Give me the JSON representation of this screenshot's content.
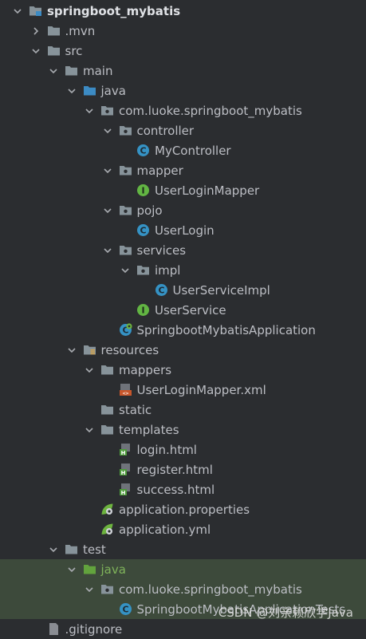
{
  "project_tree": {
    "items": [
      {
        "label": "springboot_mybatis",
        "depth": 0,
        "arrow": "down",
        "icon": "folder-module",
        "bold": true
      },
      {
        "label": ".mvn",
        "depth": 1,
        "arrow": "right",
        "icon": "folder"
      },
      {
        "label": "src",
        "depth": 1,
        "arrow": "down",
        "icon": "folder"
      },
      {
        "label": "main",
        "depth": 2,
        "arrow": "down",
        "icon": "folder"
      },
      {
        "label": "java",
        "depth": 3,
        "arrow": "down",
        "icon": "folder-source"
      },
      {
        "label": "com.luoke.springboot_mybatis",
        "depth": 4,
        "arrow": "down",
        "icon": "package"
      },
      {
        "label": "controller",
        "depth": 5,
        "arrow": "down",
        "icon": "package"
      },
      {
        "label": "MyController",
        "depth": 6,
        "arrow": "none",
        "icon": "class"
      },
      {
        "label": "mapper",
        "depth": 5,
        "arrow": "down",
        "icon": "package"
      },
      {
        "label": "UserLoginMapper",
        "depth": 6,
        "arrow": "none",
        "icon": "interface"
      },
      {
        "label": "pojo",
        "depth": 5,
        "arrow": "down",
        "icon": "package"
      },
      {
        "label": "UserLogin",
        "depth": 6,
        "arrow": "none",
        "icon": "class"
      },
      {
        "label": "services",
        "depth": 5,
        "arrow": "down",
        "icon": "package"
      },
      {
        "label": "impl",
        "depth": 6,
        "arrow": "down",
        "icon": "package"
      },
      {
        "label": "UserServiceImpl",
        "depth": 7,
        "arrow": "none",
        "icon": "class"
      },
      {
        "label": "UserService",
        "depth": 6,
        "arrow": "none",
        "icon": "interface"
      },
      {
        "label": "SpringbootMybatisApplication",
        "depth": 5,
        "arrow": "none",
        "icon": "spring-class"
      },
      {
        "label": "resources",
        "depth": 3,
        "arrow": "down",
        "icon": "folder-resources"
      },
      {
        "label": "mappers",
        "depth": 4,
        "arrow": "down",
        "icon": "folder"
      },
      {
        "label": "UserLoginMapper.xml",
        "depth": 5,
        "arrow": "none",
        "icon": "xml"
      },
      {
        "label": "static",
        "depth": 4,
        "arrow": "none",
        "icon": "folder"
      },
      {
        "label": "templates",
        "depth": 4,
        "arrow": "down",
        "icon": "folder"
      },
      {
        "label": "login.html",
        "depth": 5,
        "arrow": "none",
        "icon": "html"
      },
      {
        "label": "register.html",
        "depth": 5,
        "arrow": "none",
        "icon": "html"
      },
      {
        "label": "success.html",
        "depth": 5,
        "arrow": "none",
        "icon": "html"
      },
      {
        "label": "application.properties",
        "depth": 4,
        "arrow": "none",
        "icon": "spring-config"
      },
      {
        "label": "application.yml",
        "depth": 4,
        "arrow": "none",
        "icon": "spring-config"
      },
      {
        "label": "test",
        "depth": 2,
        "arrow": "down",
        "icon": "folder"
      },
      {
        "label": "java",
        "depth": 3,
        "arrow": "down",
        "icon": "folder-test",
        "green": true,
        "selected": true
      },
      {
        "label": "com.luoke.springboot_mybatis",
        "depth": 4,
        "arrow": "down",
        "icon": "package",
        "selected": true
      },
      {
        "label": "SpringbootMybatisApplicationTests",
        "depth": 5,
        "arrow": "none",
        "icon": "class",
        "selected": true
      },
      {
        "label": ".gitignore",
        "depth": 1,
        "arrow": "none",
        "icon": "file"
      }
    ]
  },
  "watermark": "CSDN @刘亲赖欣学Java",
  "colors": {
    "background": "#2b2d30",
    "selected_row": "#3d4a3b",
    "text": "#bcbec4",
    "class_icon": "#3592c4",
    "interface_icon": "#62b543",
    "spring_icon": "#6db33f",
    "folder": "#87939a",
    "source_folder": "#3c8bc4",
    "test_folder": "#62a33d"
  }
}
